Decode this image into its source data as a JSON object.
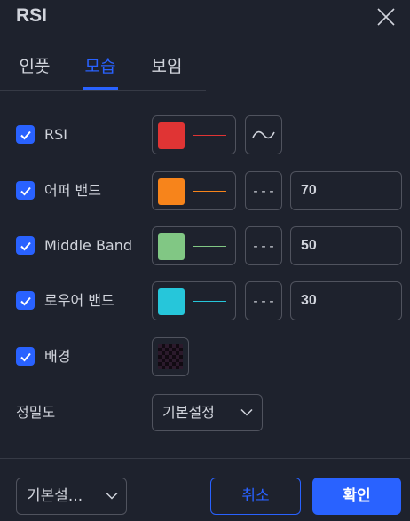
{
  "title": "RSI",
  "tabs": [
    {
      "label": "인풋",
      "active": false
    },
    {
      "label": "모습",
      "active": true
    },
    {
      "label": "보임",
      "active": false
    }
  ],
  "rows": [
    {
      "label": "RSI",
      "checked": true,
      "color": "#e03434",
      "line_style": "curve"
    },
    {
      "label": "어퍼 밴드",
      "checked": true,
      "color": "#f7841b",
      "line_style": "---",
      "value": "70"
    },
    {
      "label": "Middle Band",
      "checked": true,
      "color": "#81c784",
      "line_style": "---",
      "value": "50"
    },
    {
      "label": "로우어 밴드",
      "checked": true,
      "color": "#26c6da",
      "line_style": "---",
      "value": "30"
    },
    {
      "label": "배경",
      "checked": true
    }
  ],
  "precision": {
    "label": "정밀도",
    "selected": "기본설정"
  },
  "footer": {
    "defaults_label": "기본설...",
    "cancel_label": "취소",
    "ok_label": "확인"
  },
  "colors": {
    "accent": "#2962ff",
    "background": "#1e222d",
    "border": "#50535e"
  }
}
